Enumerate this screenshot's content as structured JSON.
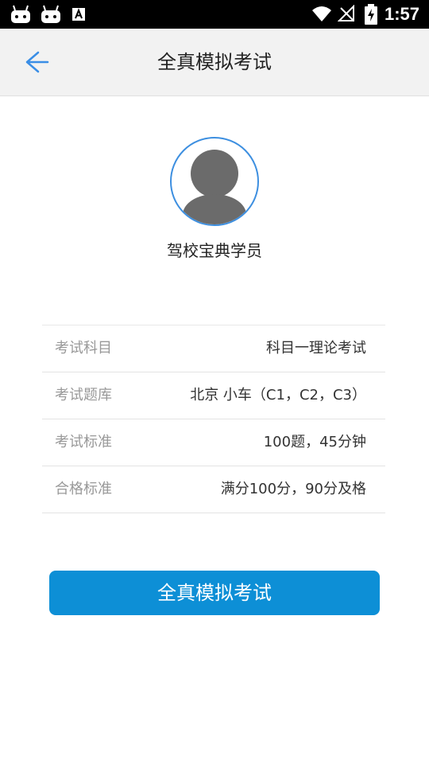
{
  "status_bar": {
    "time": "1:57",
    "icons": [
      "android-debug-icon",
      "android-debug-icon",
      "a-letter-icon",
      "wifi-icon",
      "no-signal-icon",
      "battery-charging-icon"
    ]
  },
  "header": {
    "title": "全真模拟考试",
    "back_icon": "arrow-left-icon"
  },
  "profile": {
    "avatar_icon": "user-silhouette-icon",
    "username": "驾校宝典学员"
  },
  "info": [
    {
      "label": "考试科目",
      "value": "科目一理论考试"
    },
    {
      "label": "考试题库",
      "value": "北京 小车（C1，C2，C3）"
    },
    {
      "label": "考试标准",
      "value": "100题，45分钟"
    },
    {
      "label": "合格标准",
      "value": "满分100分，90分及格"
    }
  ],
  "start_button": {
    "label": "全真模拟考试"
  },
  "colors": {
    "accent": "#0d8fd6",
    "avatar_ring": "#3d8fe0",
    "back_arrow": "#3a8ee6",
    "header_bg": "#f2f2f2"
  }
}
